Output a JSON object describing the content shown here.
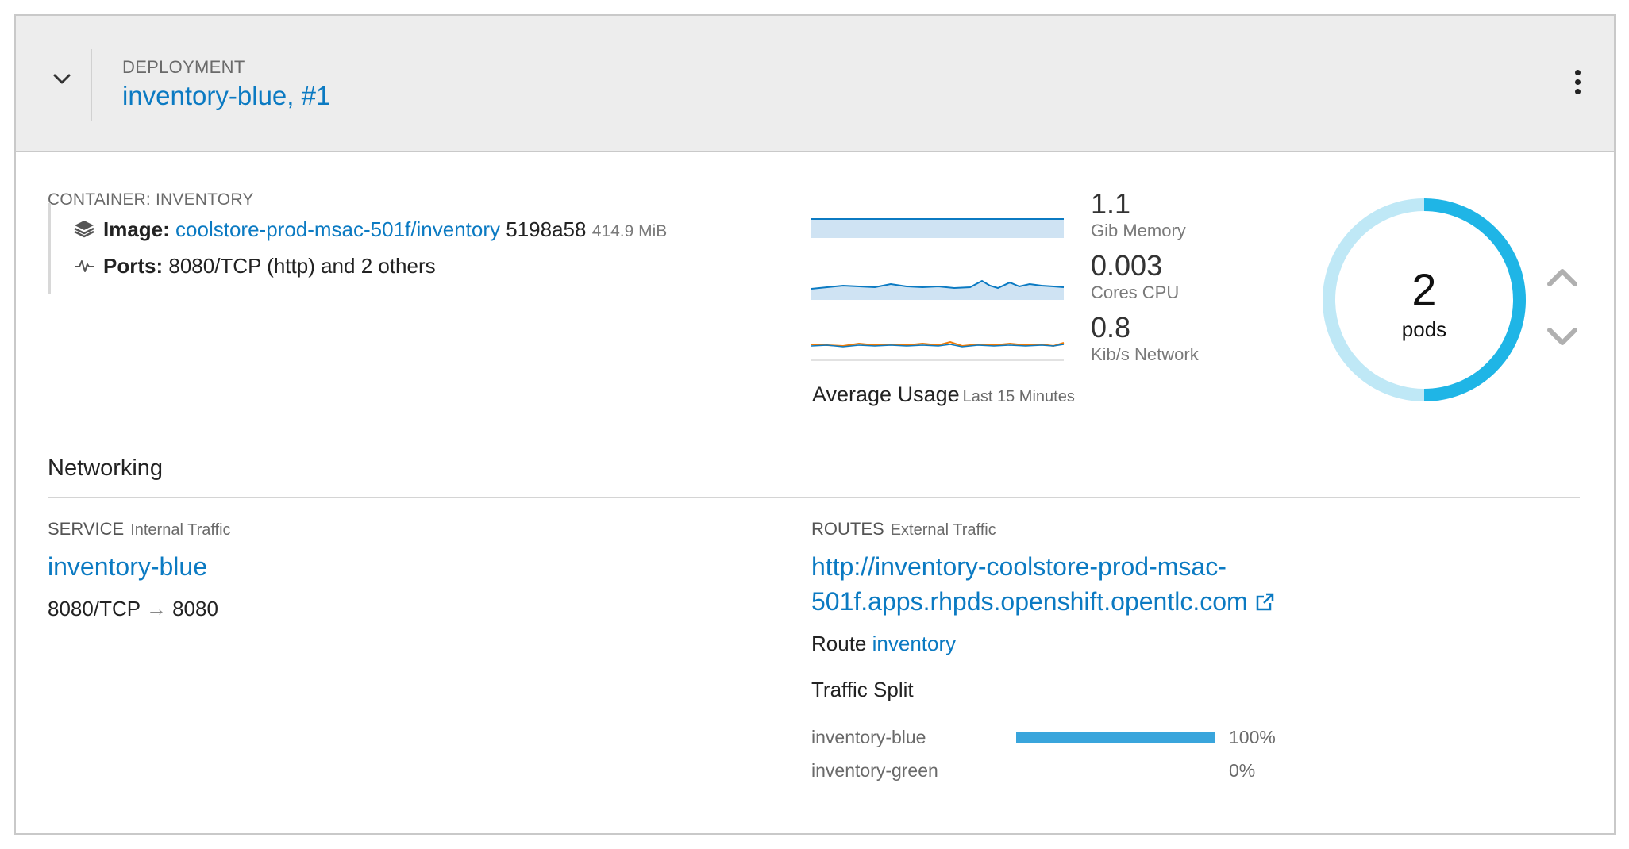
{
  "header": {
    "type_label": "DEPLOYMENT",
    "name": "inventory-blue",
    "separator": ", ",
    "revision": "#1"
  },
  "container": {
    "section_label": "CONTAINER: INVENTORY",
    "image_label": "Image:",
    "image_link": "coolstore-prod-msac-501f/inventory",
    "image_hash": "5198a58",
    "image_size": "414.9 MiB",
    "ports_label": "Ports:",
    "ports_value": "8080/TCP (http) and 2 others"
  },
  "metrics": {
    "memory": {
      "value": "1.1",
      "unit": "Gib Memory"
    },
    "cpu": {
      "value": "0.003",
      "unit": "Cores CPU"
    },
    "network": {
      "value": "0.8",
      "unit": "Kib/s Network"
    },
    "avg_label": "Average Usage",
    "avg_sub": "Last 15 Minutes",
    "colors": {
      "primary": "#0b7ac2",
      "fill": "#cfe3f3",
      "network_out": "#ec7a08"
    }
  },
  "pods": {
    "count": "2",
    "label": "pods",
    "ring_color": "#1fb5e6",
    "ring_track_color": "#bfe8f6"
  },
  "networking": {
    "title": "Networking",
    "service": {
      "header": "SERVICE",
      "header_sub": "Internal Traffic",
      "name": "inventory-blue",
      "port_from": "8080/TCP",
      "arrow": "→",
      "port_to": "8080"
    },
    "routes": {
      "header": "ROUTES",
      "header_sub": "External Traffic",
      "url_line1": "http://inventory-coolstore-prod-msac-",
      "url_line2": "501f.apps.rhpds.openshift.opentlc.com",
      "route_label": "Route",
      "route_name": "inventory",
      "traffic_split_title": "Traffic Split",
      "split": [
        {
          "name": "inventory-blue",
          "percent": "100%",
          "fraction": 1.0
        },
        {
          "name": "inventory-green",
          "percent": "0%",
          "fraction": 0.0
        }
      ]
    }
  }
}
